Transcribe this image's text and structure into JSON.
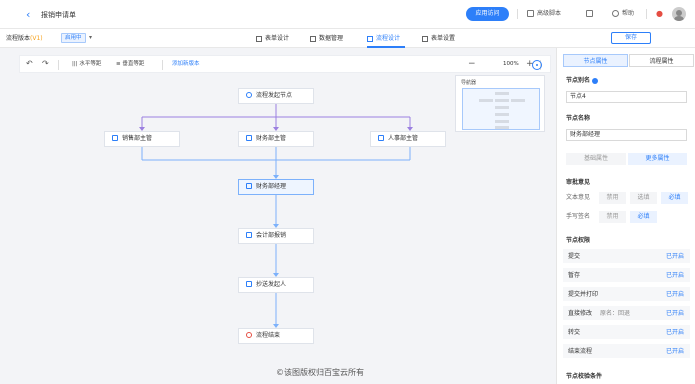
{
  "header": {
    "title": "报销申请单",
    "apply_button": "应用访问",
    "tools": [
      "高级脚本",
      "帮助"
    ]
  },
  "subheader": {
    "version_label": "流程版本",
    "version_value": "(V1)",
    "status": "启用中",
    "tabs": [
      {
        "label": "表单设计",
        "active": false
      },
      {
        "label": "数据管理",
        "active": false
      },
      {
        "label": "流程设计",
        "active": true
      },
      {
        "label": "表单设置",
        "active": false
      }
    ],
    "save_button": "保存"
  },
  "toolbar": {
    "undo_icon": "undo-icon",
    "redo_icon": "redo-icon",
    "h_align": "水平等距",
    "v_align": "垂直等距",
    "version_link": "添加新版本",
    "zoom": "100%"
  },
  "navigator": {
    "title": "导航器"
  },
  "flow": {
    "nodes": [
      {
        "id": "start",
        "label": "流程发起节点"
      },
      {
        "id": "sales",
        "label": "销售部主管"
      },
      {
        "id": "finance",
        "label": "财务部主管"
      },
      {
        "id": "hr",
        "label": "人事部主管"
      },
      {
        "id": "fin_mgr",
        "label": "财务部经理"
      },
      {
        "id": "cashier",
        "label": "会计部报销"
      },
      {
        "id": "cc",
        "label": "抄送发起人"
      },
      {
        "id": "end",
        "label": "流程结束"
      }
    ]
  },
  "panel": {
    "tabs": [
      {
        "label": "节点属性",
        "active": true
      },
      {
        "label": "流程属性",
        "active": false
      }
    ],
    "node_alias_label": "节点别名",
    "node_alias_value": "节点4",
    "node_name_label": "节点名称",
    "node_name_value": "财务部经理",
    "basic_props": "基础属性",
    "more_props": "更多属性",
    "opinion_label": "审批意见",
    "text_opinion": "文本意见",
    "handwriting": "手写签名",
    "opt_disable": "禁用",
    "opt_optional": "选填",
    "opt_required": "必填",
    "perms_label": "节点权限",
    "permissions": [
      {
        "name": "提交",
        "mark": "",
        "value": "已开启"
      },
      {
        "name": "暂存",
        "mark": "",
        "value": "已开启"
      },
      {
        "name": "提交并打印",
        "mark": "",
        "value": "已开启"
      },
      {
        "name": "直接修改",
        "mark": "原名：回退",
        "value": "已开启"
      },
      {
        "name": "转交",
        "mark": "",
        "value": "已开启"
      },
      {
        "name": "结束流程",
        "mark": "",
        "value": "已开启"
      }
    ],
    "conditions_label": "节点校验条件"
  },
  "watermark": "©该图版权归百宝云所有",
  "colors": {
    "accent": "#2d7ff9",
    "branch_line": "#9b7fe0",
    "main_line": "#7cb1fb"
  }
}
